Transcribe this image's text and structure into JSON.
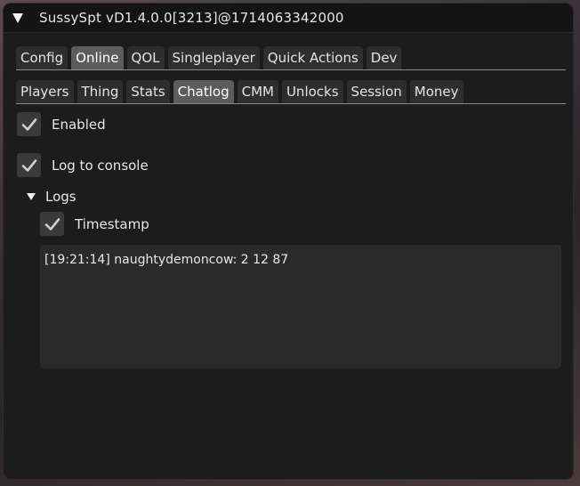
{
  "window": {
    "title": "SussySpt vD1.4.0.0[3213]@1714063342000"
  },
  "tabs_main": [
    {
      "label": "Config",
      "active": false
    },
    {
      "label": "Online",
      "active": true
    },
    {
      "label": "QOL",
      "active": false
    },
    {
      "label": "Singleplayer",
      "active": false
    },
    {
      "label": "Quick Actions",
      "active": false
    },
    {
      "label": "Dev",
      "active": false
    }
  ],
  "tabs_sub": [
    {
      "label": "Players",
      "active": false
    },
    {
      "label": "Thing",
      "active": false
    },
    {
      "label": "Stats",
      "active": false
    },
    {
      "label": "Chatlog",
      "active": true
    },
    {
      "label": "CMM",
      "active": false
    },
    {
      "label": "Unlocks",
      "active": false
    },
    {
      "label": "Session",
      "active": false
    },
    {
      "label": "Money",
      "active": false
    }
  ],
  "chatlog": {
    "enabled": {
      "label": "Enabled",
      "checked": true
    },
    "log_to_console": {
      "label": "Log to console",
      "checked": true
    },
    "logs": {
      "label": "Logs",
      "expanded": true,
      "timestamp": {
        "label": "Timestamp",
        "checked": true
      },
      "lines": [
        "[19:21:14] naughtydemoncow: 2 12 87"
      ]
    }
  },
  "icons": {
    "collapse": "triangle-down-icon",
    "check": "checkmark-icon"
  }
}
